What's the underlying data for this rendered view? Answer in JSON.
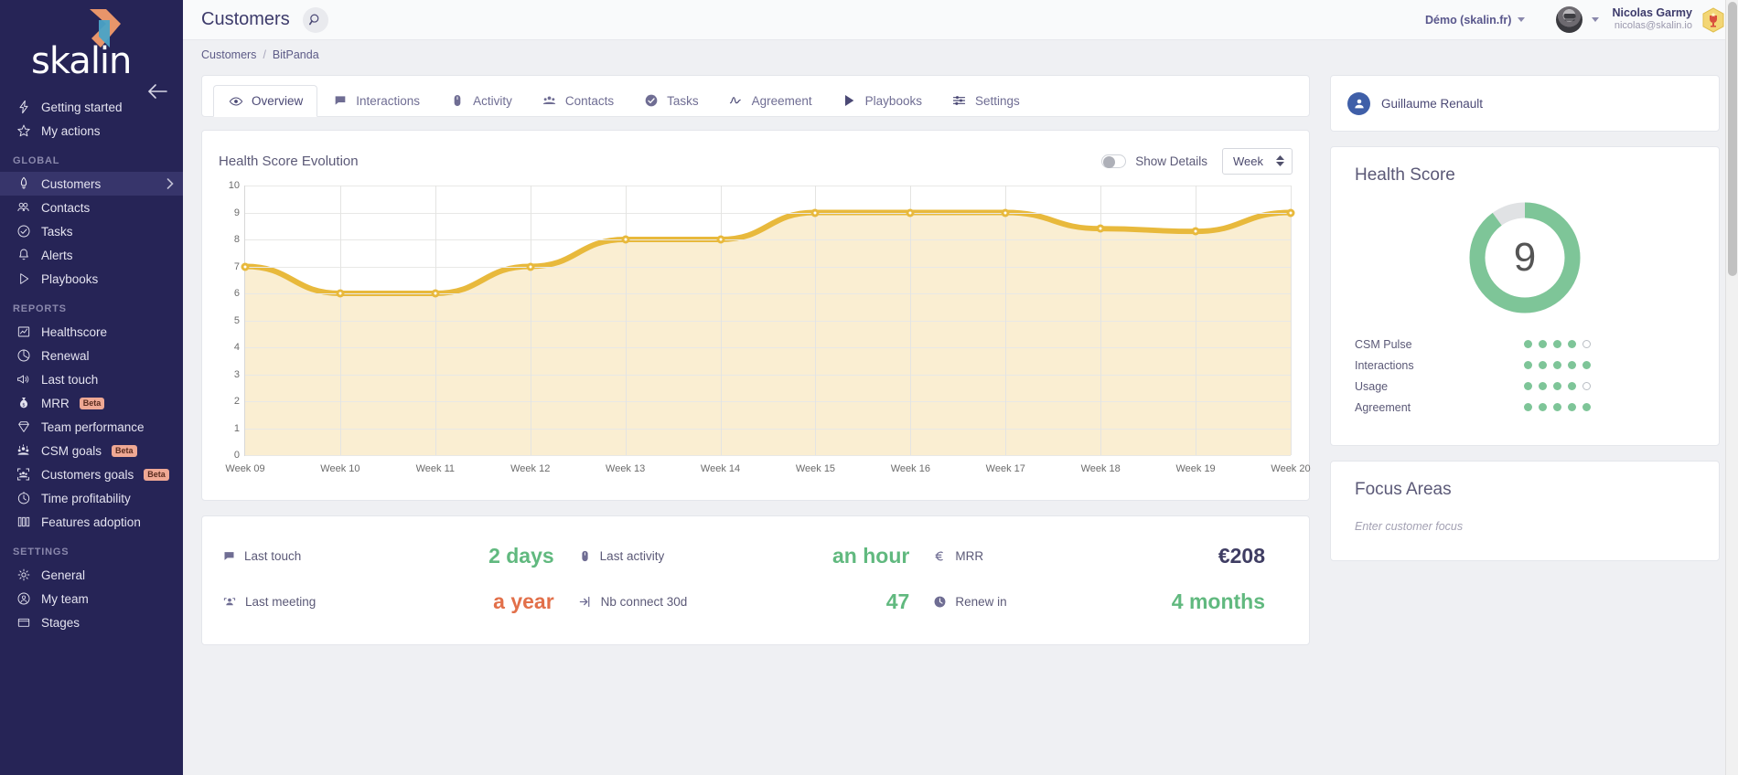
{
  "brand": {
    "name": "skalin",
    "accent_orange": "#e8956a",
    "accent_blue": "#4aa3c7",
    "sidebar_bg": "#262456"
  },
  "sidebar": {
    "top_items": [
      {
        "label": "Getting started",
        "icon": "bolt-icon"
      },
      {
        "label": "My actions",
        "icon": "star-icon"
      }
    ],
    "sections": [
      {
        "title": "GLOBAL",
        "items": [
          {
            "label": "Customers",
            "icon": "rocket-icon",
            "active": true,
            "chevron": true
          },
          {
            "label": "Contacts",
            "icon": "people-icon"
          },
          {
            "label": "Tasks",
            "icon": "check-circle-icon"
          },
          {
            "label": "Alerts",
            "icon": "bell-icon"
          },
          {
            "label": "Playbooks",
            "icon": "play-icon"
          }
        ]
      },
      {
        "title": "REPORTS",
        "items": [
          {
            "label": "Healthscore",
            "icon": "chart-line-icon"
          },
          {
            "label": "Renewal",
            "icon": "pie-chart-icon"
          },
          {
            "label": "Last touch",
            "icon": "megaphone-icon"
          },
          {
            "label": "MRR",
            "icon": "money-bag-icon",
            "badge": "Beta"
          },
          {
            "label": "Team performance",
            "icon": "diamond-icon"
          },
          {
            "label": "CSM goals",
            "icon": "team-goal-icon",
            "badge": "Beta"
          },
          {
            "label": "Customers goals",
            "icon": "customers-goal-icon",
            "badge": "Beta"
          },
          {
            "label": "Time profitability",
            "icon": "stopwatch-icon"
          },
          {
            "label": "Features adoption",
            "icon": "columns-icon"
          }
        ]
      },
      {
        "title": "SETTINGS",
        "items": [
          {
            "label": "General",
            "icon": "gear-icon"
          },
          {
            "label": "My team",
            "icon": "user-circle-icon"
          },
          {
            "label": "Stages",
            "icon": "folder-icon"
          }
        ]
      }
    ]
  },
  "topbar": {
    "title": "Customers",
    "search_icon": "search-icon",
    "org": "Démo (skalin.fr)",
    "user_name": "Nicolas Garmy",
    "user_email": "nicolas@skalin.io",
    "trophy_icon": "trophy-badge-icon"
  },
  "breadcrumb": {
    "root": "Customers",
    "separator": "/",
    "current": "BitPanda"
  },
  "tabs": [
    {
      "label": "Overview",
      "icon": "eye-icon",
      "active": true
    },
    {
      "label": "Interactions",
      "icon": "chat-bubble-icon",
      "active": false
    },
    {
      "label": "Activity",
      "icon": "mouse-icon",
      "active": false
    },
    {
      "label": "Contacts",
      "icon": "people-group-icon",
      "active": false
    },
    {
      "label": "Tasks",
      "icon": "check-circle-icon",
      "active": false
    },
    {
      "label": "Agreement",
      "icon": "signature-icon",
      "active": false
    },
    {
      "label": "Playbooks",
      "icon": "play-triangle-icon",
      "active": false
    },
    {
      "label": "Settings",
      "icon": "sliders-icon",
      "active": false
    }
  ],
  "chart_card": {
    "title": "Health Score Evolution",
    "toggle_label": "Show Details",
    "toggle_on": false,
    "period_value": "Week"
  },
  "chart_data": {
    "type": "area",
    "title": "Health Score Evolution",
    "xlabel": "",
    "ylabel": "",
    "ylim": [
      0,
      10
    ],
    "ytick_values": [
      0,
      1,
      2,
      3,
      4,
      5,
      6,
      7,
      8,
      9,
      10
    ],
    "grid": true,
    "legend": "none",
    "line_color": "#e8b93c",
    "fill_color": "#faeed2",
    "categories": [
      "Week 09",
      "Week 10",
      "Week 11",
      "Week 12",
      "Week 13",
      "Week 14",
      "Week 15",
      "Week 16",
      "Week 17",
      "Week 18",
      "Week 19",
      "Week 20"
    ],
    "values": [
      7,
      6,
      6,
      7,
      8,
      8,
      9,
      9,
      9,
      8.4,
      8.3,
      9
    ]
  },
  "metrics": [
    [
      {
        "label": "Last touch",
        "icon": "chat-icon",
        "value": "2 days",
        "color": "green"
      },
      {
        "label": "Last activity",
        "icon": "mouse-icon",
        "value": "an hour",
        "color": "green"
      },
      {
        "label": "MRR",
        "icon": "euro-icon",
        "value": "€208",
        "color": "dark"
      }
    ],
    [
      {
        "label": "Last meeting",
        "icon": "meeting-icon",
        "value": "a year",
        "color": "orange"
      },
      {
        "label": "Nb connect 30d",
        "icon": "login-icon",
        "value": "47",
        "color": "green"
      },
      {
        "label": "Renew in",
        "icon": "clock-icon",
        "value": "4 months",
        "color": "green"
      }
    ]
  ],
  "owner": {
    "name": "Guillaume Renault",
    "avatar_icon": "user-avatar-icon"
  },
  "health": {
    "title": "Health Score",
    "score": "9",
    "score_pct": 90,
    "ring_color": "#7ec598",
    "ring_track": "#e0e2e4",
    "rows": [
      {
        "label": "CSM Pulse",
        "filled": 4,
        "total": 5
      },
      {
        "label": "Interactions",
        "filled": 5,
        "total": 5
      },
      {
        "label": "Usage",
        "filled": 4,
        "total": 5
      },
      {
        "label": "Agreement",
        "filled": 5,
        "total": 5
      }
    ]
  },
  "focus": {
    "title": "Focus Areas",
    "placeholder": "Enter customer focus"
  }
}
